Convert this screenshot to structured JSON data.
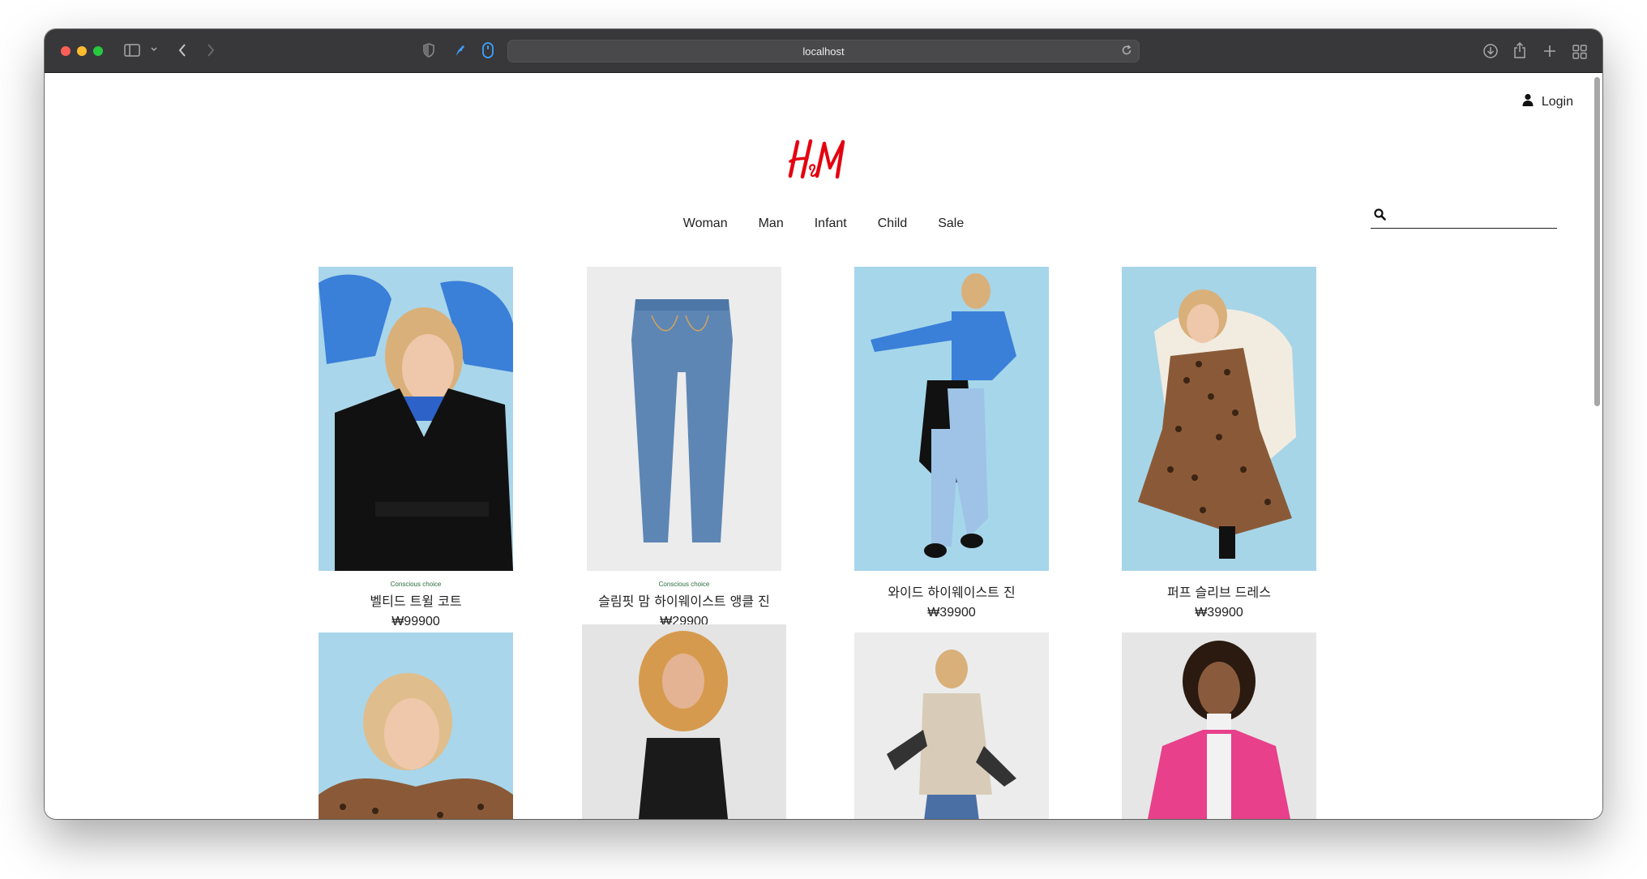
{
  "browser": {
    "url": "localhost",
    "colors": {
      "toolbar": "#38383a",
      "address_bar": "#49494b"
    }
  },
  "header": {
    "login_label": "Login",
    "brand": "H&M",
    "brand_color": "#e50010"
  },
  "nav": {
    "items": [
      {
        "label": "Woman"
      },
      {
        "label": "Man"
      },
      {
        "label": "Infant"
      },
      {
        "label": "Child"
      },
      {
        "label": "Sale"
      }
    ]
  },
  "search": {
    "value": "",
    "placeholder": ""
  },
  "products": [
    {
      "badge": "Conscious choice",
      "name": "벨티드 트윌 코트",
      "price": "₩99900",
      "icon": "woman-black-coat-photo"
    },
    {
      "badge": "Conscious choice",
      "name": "슬림핏 맘 하이웨이스트 앵클 진",
      "price": "₩29900",
      "icon": "blue-jeans-photo"
    },
    {
      "badge": "",
      "name": "와이드 하이웨이스트 진",
      "price": "₩39900",
      "icon": "woman-wide-jeans-photo"
    },
    {
      "badge": "",
      "name": "퍼프 슬리브 드레스",
      "price": "₩39900",
      "icon": "leopard-dress-photo"
    },
    {
      "badge": "",
      "name": "",
      "price": "",
      "icon": "leopard-top-photo"
    },
    {
      "badge": "",
      "name": "",
      "price": "",
      "icon": "black-vest-photo"
    },
    {
      "badge": "",
      "name": "",
      "price": "",
      "icon": "beige-blazer-photo"
    },
    {
      "badge": "",
      "name": "",
      "price": "",
      "icon": "pink-hoodie-photo"
    }
  ]
}
